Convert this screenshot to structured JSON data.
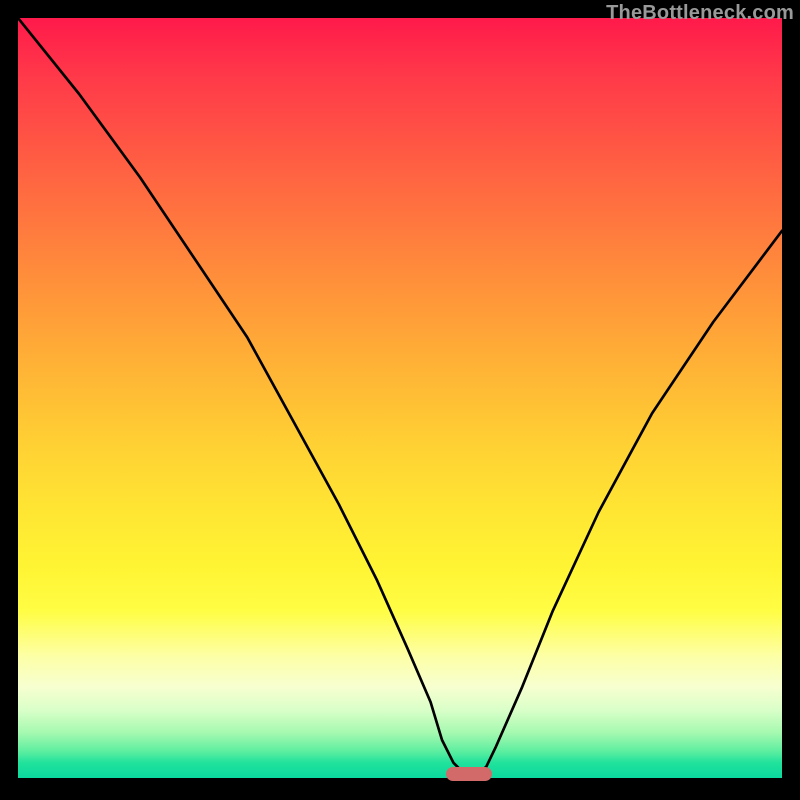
{
  "watermark": {
    "text": "TheBottleneck.com"
  },
  "chart_data": {
    "type": "line",
    "title": "",
    "xlabel": "",
    "ylabel": "",
    "xlim": [
      0,
      100
    ],
    "ylim": [
      0,
      100
    ],
    "grid": false,
    "legend": false,
    "series": [
      {
        "name": "bottleneck-curve",
        "color": "#000000",
        "x": [
          0,
          8,
          16,
          24,
          30,
          36,
          42,
          47,
          51,
          54,
          55.5,
          57,
          58.5,
          60,
          61.3,
          62.5,
          66,
          70,
          76,
          83,
          91,
          100
        ],
        "values": [
          100,
          90,
          79,
          67,
          58,
          47,
          36,
          26,
          17,
          10,
          5,
          2,
          0.5,
          0.4,
          1.5,
          4,
          12,
          22,
          35,
          48,
          60,
          72
        ]
      }
    ],
    "marker": {
      "name": "optimal-range",
      "color": "#d26a6a",
      "x_start": 56,
      "x_end": 62,
      "y": 0
    },
    "background_gradient": {
      "top": "#ff1a4b",
      "mid": "#ffe633",
      "bottom": "#0bd99e"
    }
  }
}
